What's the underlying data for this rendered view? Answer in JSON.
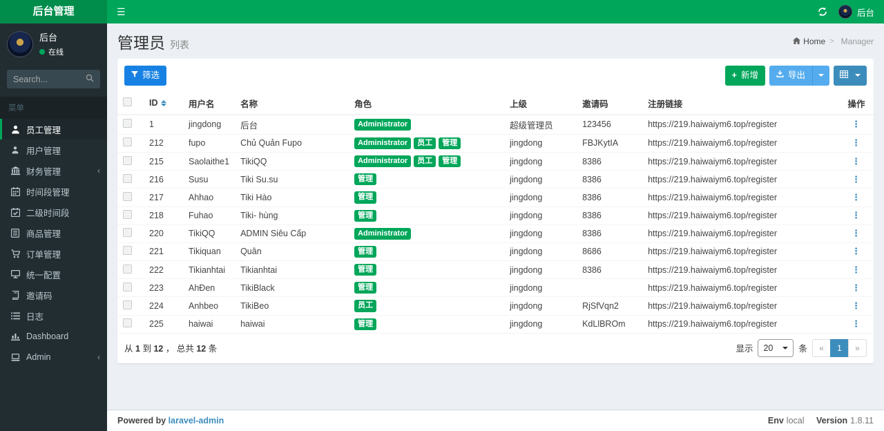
{
  "navbar": {
    "brand": "后台管理",
    "user_label": "后台"
  },
  "sidebar": {
    "user": {
      "name": "后台",
      "status": "在线"
    },
    "search_placeholder": "Search...",
    "menu_header": "菜单",
    "items": [
      {
        "label": "员工管理",
        "icon": "staff",
        "active": true,
        "chevron": false
      },
      {
        "label": "用户管理",
        "icon": "user",
        "active": false,
        "chevron": false
      },
      {
        "label": "财务管理",
        "icon": "bank",
        "active": false,
        "chevron": true
      },
      {
        "label": "时间段管理",
        "icon": "calendar",
        "active": false,
        "chevron": false
      },
      {
        "label": "二级时间段",
        "icon": "calendar-check",
        "active": false,
        "chevron": false
      },
      {
        "label": "商品管理",
        "icon": "goods",
        "active": false,
        "chevron": false
      },
      {
        "label": "订单管理",
        "icon": "cart",
        "active": false,
        "chevron": false
      },
      {
        "label": "统一配置",
        "icon": "desktop",
        "active": false,
        "chevron": false
      },
      {
        "label": "邀请码",
        "icon": "book",
        "active": false,
        "chevron": false
      },
      {
        "label": "日志",
        "icon": "list",
        "active": false,
        "chevron": false
      },
      {
        "label": "Dashboard",
        "icon": "chart",
        "active": false,
        "chevron": false
      },
      {
        "label": "Admin",
        "icon": "laptop",
        "active": false,
        "chevron": true
      }
    ]
  },
  "header": {
    "title": "管理员",
    "subtitle": "列表",
    "breadcrumb": [
      {
        "label": "Home",
        "home": true
      },
      {
        "label": "Manager",
        "home": false
      }
    ]
  },
  "toolbar": {
    "filter_label": "筛选",
    "new_label": "新增",
    "export_label": "导出"
  },
  "table": {
    "columns": [
      "ID",
      "用户名",
      "名称",
      "角色",
      "上级",
      "邀请码",
      "注册链接",
      "操作"
    ],
    "rows": [
      {
        "id": "1",
        "username": "jingdong",
        "name": "后台",
        "roles": [
          "Administrator"
        ],
        "parent": "超级管理员",
        "invite": "123456",
        "link": "https://219.haiwaiym6.top/register"
      },
      {
        "id": "212",
        "username": "fupo",
        "name": "Chủ Quản Fupo",
        "roles": [
          "Administrator",
          "员工",
          "管理"
        ],
        "parent": "jingdong",
        "invite": "FBJKytIA",
        "link": "https://219.haiwaiym6.top/register"
      },
      {
        "id": "215",
        "username": "Saolaithe1",
        "name": "TikiQQ",
        "roles": [
          "Administrator",
          "员工",
          "管理"
        ],
        "parent": "jingdong",
        "invite": "8386",
        "link": "https://219.haiwaiym6.top/register"
      },
      {
        "id": "216",
        "username": "Susu",
        "name": "Tiki Su.su",
        "roles": [
          "管理"
        ],
        "parent": "jingdong",
        "invite": "8386",
        "link": "https://219.haiwaiym6.top/register"
      },
      {
        "id": "217",
        "username": "Ahhao",
        "name": "Tiki Hào",
        "roles": [
          "管理"
        ],
        "parent": "jingdong",
        "invite": "8386",
        "link": "https://219.haiwaiym6.top/register"
      },
      {
        "id": "218",
        "username": "Fuhao",
        "name": "Tiki- hùng",
        "roles": [
          "管理"
        ],
        "parent": "jingdong",
        "invite": "8386",
        "link": "https://219.haiwaiym6.top/register"
      },
      {
        "id": "220",
        "username": "TikiQQ",
        "name": "ADMIN Siêu Cấp",
        "roles": [
          "Administrator"
        ],
        "parent": "jingdong",
        "invite": "8386",
        "link": "https://219.haiwaiym6.top/register"
      },
      {
        "id": "221",
        "username": "Tikiquan",
        "name": "Quân",
        "roles": [
          "管理"
        ],
        "parent": "jingdong",
        "invite": "8686",
        "link": "https://219.haiwaiym6.top/register"
      },
      {
        "id": "222",
        "username": "Tikianhtai",
        "name": "Tikianhtai",
        "roles": [
          "管理"
        ],
        "parent": "jingdong",
        "invite": "8386",
        "link": "https://219.haiwaiym6.top/register"
      },
      {
        "id": "223",
        "username": "AhĐen",
        "name": "TikiBlack",
        "roles": [
          "管理"
        ],
        "parent": "jingdong",
        "invite": "",
        "link": "https://219.haiwaiym6.top/register"
      },
      {
        "id": "224",
        "username": "Anhbeo",
        "name": "TikiBeo",
        "roles": [
          "员工"
        ],
        "parent": "jingdong",
        "invite": "RjSfVqn2",
        "link": "https://219.haiwaiym6.top/register"
      },
      {
        "id": "225",
        "username": "haiwai",
        "name": "haiwai",
        "roles": [
          "管理"
        ],
        "parent": "jingdong",
        "invite": "KdLlBROm",
        "link": "https://219.haiwaiym6.top/register"
      }
    ],
    "action_glyph": "⋮"
  },
  "table_footer": {
    "summary": {
      "prefix": "从",
      "from": "1",
      "mid": "到",
      "to": "12",
      "sep": "，",
      "total_label": "总共",
      "total": "12",
      "unit": "条"
    },
    "per_page_prefix": "显示",
    "per_page_value": "20",
    "per_page_suffix": "条",
    "pager": [
      {
        "label": "«",
        "state": "disabled"
      },
      {
        "label": "1",
        "state": "active"
      },
      {
        "label": "»",
        "state": "disabled"
      }
    ]
  },
  "footer": {
    "powered_by": "Powered by",
    "powered_link": "laravel-admin",
    "env_label": "Env",
    "env_value": "local",
    "version_label": "Version",
    "version_value": "1.8.11"
  },
  "colors": {
    "brand_green": "#00a65a",
    "brand_green_dark": "#008d4c",
    "sidebar_bg": "#222d32",
    "filter_blue": "#1781e3",
    "export_blue": "#54acee",
    "primary_blue": "#3c8dbc",
    "badge_green": "#00a65a"
  }
}
